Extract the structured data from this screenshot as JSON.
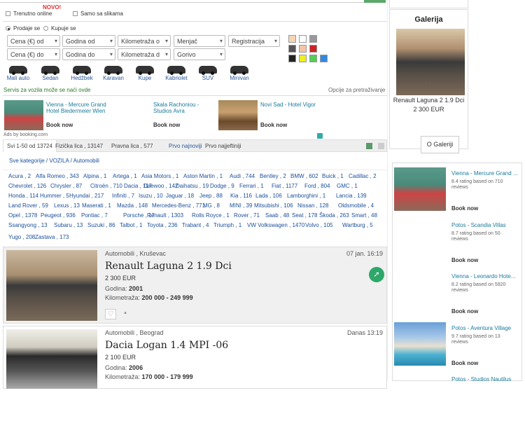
{
  "search": {
    "novo": "NOVO!",
    "trenutno_online": "Trenutno online",
    "samo_sa_slikama": "Samo sa slikama",
    "prodaje_se": "Prodaje se",
    "kupuje_se": "Kupuje se",
    "cena_od": "Cena (€) od",
    "cena_do": "Cena (€) do",
    "godina_od": "Godina od",
    "godina_do": "Godina do",
    "km_od": "Kilometraža o",
    "km_do": "Kilometraža d",
    "menjac": "Menjač",
    "gorivo": "Gorivo",
    "registracija": "Registracija",
    "servis": "Servis za vozila može se naći ovde",
    "opcije": "Opcije za pretraživanje"
  },
  "vehicle_types": [
    "Mali auto",
    "Sedan",
    "Hedžbek",
    "Karavan",
    "Kupe",
    "Kabriolet",
    "SUV",
    "Minivan"
  ],
  "colors": [
    "#f5d5b5",
    "#ffffff",
    "#999999",
    "#555555",
    "#f5c5a5",
    "#cc2222",
    "#222222",
    "#eeee22",
    "#55cc55",
    "#3388dd"
  ],
  "ads": [
    {
      "title": "Vienna - Mercure Grand Hotel Biedermeier Wien",
      "book": "Book now"
    },
    {
      "title": "Skala Rachoniou - Studios Avra",
      "book": "Book now"
    },
    {
      "title": "Novi Sad - Hotel Vigor",
      "book": "Book now"
    }
  ],
  "ads_by": "Ads by booking.com",
  "tabs": {
    "svi": "Svi 1-50 od 13724",
    "fizicka": "Fizička lica , 13147",
    "pravna": "Pravna lica , 577",
    "najnoviji": "Prvo najnoviji",
    "najjeftiniji": "Prvo najjeftiniji"
  },
  "breadcrumb": "Sve kategorije  /  VOZILA  /  Automobili",
  "brands": [
    [
      "Acura , 2",
      "Alfa Romeo , 343",
      "Alpina , 1",
      "Artega , 1",
      "Asia Motors , 1",
      "Aston Martin , 1",
      "Audi , 744",
      "Bentley , 2",
      "BMW , 602",
      "Buick , 1",
      "Cadillac , 2"
    ],
    [
      "Chevrolet , 126",
      "Chrysler , 87",
      "Citroën , 710",
      "Dacia , 117",
      "Daewoo , 142",
      "Daihatsu , 19",
      "Dodge , 9",
      "Ferrari , 1",
      "Fiat , 1177",
      "Ford , 804",
      "GMC , 1"
    ],
    [
      "Honda , 114",
      "Hummer , 5",
      "Hyundai , 217",
      "Infiniti , 7",
      "Isuzu , 10",
      "Jaguar , 18",
      "Jeep , 88",
      "Kia , 116",
      "Lada , 106",
      "Lamborghini , 1",
      "Lancia , 139"
    ],
    [
      "Land Rover , 59",
      "Lexus , 13",
      "Maserati , 1",
      "Mazda , 148",
      "Mercedes-Benz , 771",
      "MG , 8",
      "MINI , 39",
      "Mitsubishi , 106",
      "Nissan , 128",
      "Oldsmobile , 4"
    ],
    [
      "Opel , 1378",
      "Peugeot , 936",
      "Pontiac , 7",
      "Porsche , 17",
      "Renault , 1303",
      "Rolls Royce , 1",
      "Rover , 71",
      "Saab , 48",
      "Seat , 178",
      "Škoda , 263",
      "Smart , 48"
    ],
    [
      "Ssangyong , 13",
      "Subaru , 13",
      "Suzuki , 86",
      "Talbot , 1",
      "Toyota , 236",
      "Trabant , 4",
      "Triumph , 1",
      "VW Volkswagen , 1470",
      "Volvo , 105",
      "Wartburg , 5"
    ],
    [
      "Yugo , 208",
      "Zastava , 173"
    ]
  ],
  "listings": [
    {
      "category": "Automobili , Kruševac",
      "date": "07 jan. 16:19",
      "title": "Renault Laguna 2 1.9 Dci",
      "price": "2 300 EUR",
      "godina_label": "Godina:",
      "godina": "2001",
      "km_label": "Kilometraža:",
      "km": "200 000 - 249 999"
    },
    {
      "category": "Automobili , Beograd",
      "date": "Danas 13:19",
      "title": "Dacia Logan 1.4 MPI -06",
      "price": "2 100 EUR",
      "godina_label": "Godina:",
      "godina": "2006",
      "km_label": "Kilometraža:",
      "km": "170 000 - 179 999"
    }
  ],
  "galerija": {
    "heading": "Galerija",
    "title": "Renault Laguna 2 1.9 Dci",
    "price": "2 300 EUR",
    "button": "O Galeriji"
  },
  "hotels": [
    {
      "name": "Vienna - Mercure Grand ...",
      "rating": "8.4 rating based on 710 reviews",
      "book": "Book now"
    },
    {
      "name": "Potos - Scandia Villas",
      "rating": "8.7 rating based on 50 reviews",
      "book": "Book now"
    },
    {
      "name": "Vienna - Leonardo Hote...",
      "rating": "8.2 rating based on 5920 reviews",
      "book": "Book now"
    },
    {
      "name": "Potos - Aventura Village",
      "rating": "9.7 rating based on 13 reviews",
      "book": "Book now"
    },
    {
      "name": "Potos - Studios Nautilus",
      "rating": "",
      "book": ""
    }
  ]
}
